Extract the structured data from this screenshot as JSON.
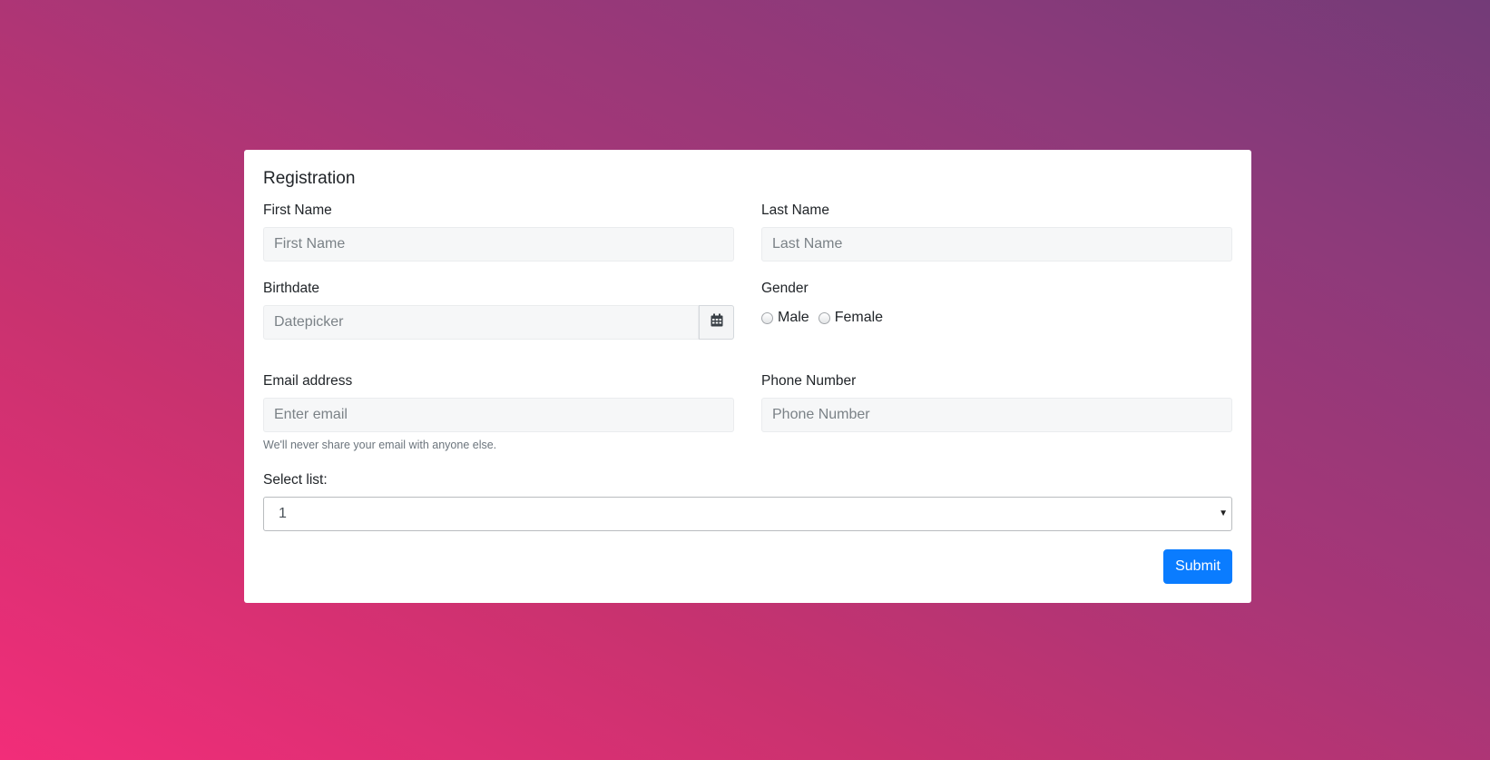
{
  "form": {
    "title": "Registration",
    "first_name": {
      "label": "First Name",
      "placeholder": "First Name",
      "value": ""
    },
    "last_name": {
      "label": "Last Name",
      "placeholder": "Last Name",
      "value": ""
    },
    "birthdate": {
      "label": "Birthdate",
      "placeholder": "Datepicker",
      "value": "",
      "icon": "calendar-icon"
    },
    "gender": {
      "label": "Gender",
      "options": [
        "Male",
        "Female"
      ],
      "selected": null
    },
    "email": {
      "label": "Email address",
      "placeholder": "Enter email",
      "value": "",
      "help": "We'll never share your email with anyone else."
    },
    "phone": {
      "label": "Phone Number",
      "placeholder": "Phone Number",
      "value": ""
    },
    "select_list": {
      "label": "Select list:",
      "selected": "1"
    },
    "submit_label": "Submit"
  },
  "colors": {
    "primary": "#0a7cff",
    "gradient_start": "#f22d79",
    "gradient_end": "#733b78"
  }
}
